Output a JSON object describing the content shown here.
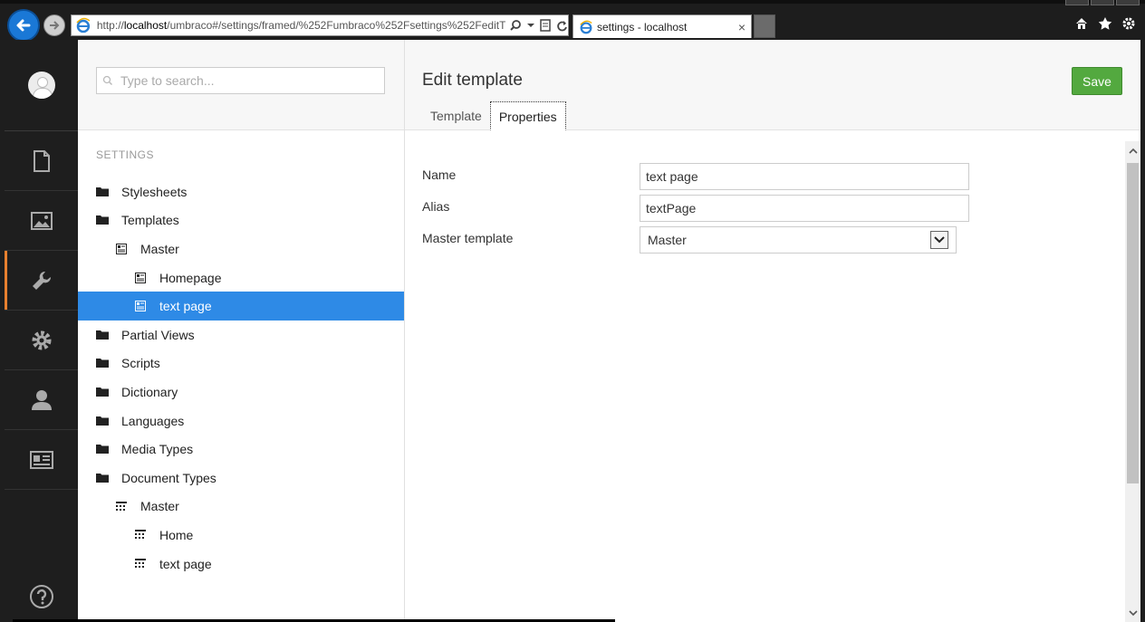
{
  "browser": {
    "address": "http://localhost/umbraco#/settings/framed/%252Fumbraco%252Fsettings%252FeditT",
    "address_host": "localhost",
    "address_prefix": "http://",
    "address_suffix": "/umbraco#/settings/framed/%252Fumbraco%252Fsettings%252FeditT",
    "tab_title": "settings - localhost",
    "tab_close": "×"
  },
  "tree": {
    "search_placeholder": "Type to search...",
    "section_title": "SETTINGS",
    "nodes": [
      {
        "label": "Stylesheets",
        "icon": "folder-icon",
        "depth": 0,
        "selected": false
      },
      {
        "label": "Templates",
        "icon": "folder-icon",
        "depth": 0,
        "selected": false
      },
      {
        "label": "Master",
        "icon": "template-icon",
        "depth": 1,
        "selected": false
      },
      {
        "label": "Homepage",
        "icon": "template-icon",
        "depth": 2,
        "selected": false
      },
      {
        "label": "text page",
        "icon": "template-icon",
        "depth": 2,
        "selected": true
      },
      {
        "label": "Partial Views",
        "icon": "folder-icon",
        "depth": 0,
        "selected": false
      },
      {
        "label": "Scripts",
        "icon": "folder-icon",
        "depth": 0,
        "selected": false
      },
      {
        "label": "Dictionary",
        "icon": "folder-icon",
        "depth": 0,
        "selected": false
      },
      {
        "label": "Languages",
        "icon": "folder-icon",
        "depth": 0,
        "selected": false
      },
      {
        "label": "Media Types",
        "icon": "folder-icon",
        "depth": 0,
        "selected": false
      },
      {
        "label": "Document Types",
        "icon": "folder-icon",
        "depth": 0,
        "selected": false
      },
      {
        "label": "Master",
        "icon": "doctype-icon",
        "depth": 1,
        "selected": false
      },
      {
        "label": "Home",
        "icon": "doctype-icon",
        "depth": 2,
        "selected": false
      },
      {
        "label": "text page",
        "icon": "doctype-icon",
        "depth": 2,
        "selected": false
      }
    ]
  },
  "editor": {
    "title": "Edit template",
    "save_label": "Save",
    "tabs": [
      {
        "label": "Template",
        "active": false
      },
      {
        "label": "Properties",
        "active": true
      }
    ],
    "fields": {
      "name_label": "Name",
      "name_value": "text page",
      "alias_label": "Alias",
      "alias_value": "textPage",
      "master_label": "Master template",
      "master_value": "Master"
    }
  },
  "colors": {
    "accent": "#2e8ae6",
    "save": "#53a93f",
    "section_active": "#e8802f",
    "sidebar": "#1e1e1e"
  }
}
